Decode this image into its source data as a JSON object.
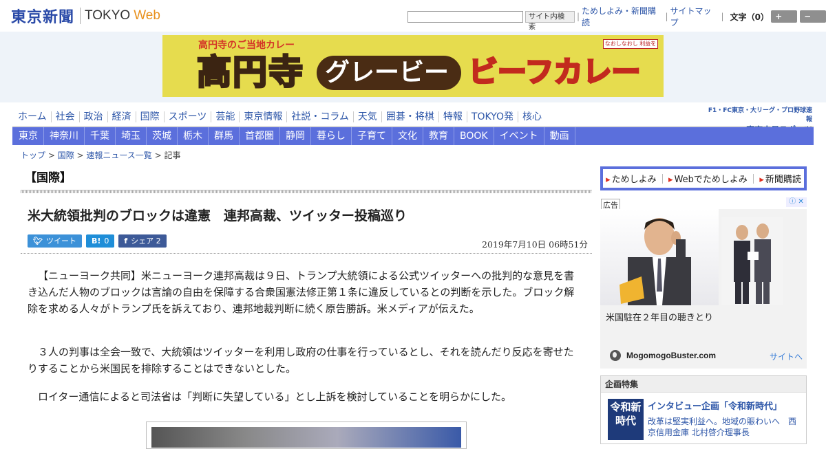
{
  "header": {
    "logo_jp": "東京新聞",
    "logo_tokyo": "TOKYO",
    "logo_web": "Web",
    "search_button": "サイト内検索",
    "links": [
      "ためしよみ・新聞購読",
      "サイトマップ"
    ],
    "font_size_label": "文字（0）",
    "bigger": "+ 大",
    "smaller": "− 小"
  },
  "banner": {
    "top_text": "高円寺のご当地カレー",
    "big_text": "高円寺",
    "pill_text": "グレービー",
    "yellow_text": "ビーフカレー",
    "badge": "なおしなおし 利益を"
  },
  "nav_main": [
    "ホーム",
    "社会",
    "政治",
    "経済",
    "国際",
    "スポーツ",
    "芸能",
    "東京情報",
    "社説・コラム",
    "天気",
    "囲碁・将棋",
    "特報",
    "TOKYO発",
    "核心"
  ],
  "chunichi": {
    "top": "F1・FC東京・大リーグ・プロ野球速報",
    "bottom": "東京中日スポーツ"
  },
  "nav_sub": [
    "東京",
    "神奈川",
    "千葉",
    "埼玉",
    "茨城",
    "栃木",
    "群馬",
    "首都圏",
    "静岡",
    "暮らし",
    "子育て",
    "文化",
    "教育",
    "BOOK",
    "イベント",
    "動画"
  ],
  "breadcrumb": {
    "items": [
      "トップ",
      "国際",
      "速報ニュース一覧"
    ],
    "current": "記事",
    "sep": " > "
  },
  "article": {
    "section": "【国際】",
    "headline": "米大統領批判のブロックは違憲　連邦高裁、ツイッター投稿巡り",
    "date": "2019年7月10日 06時51分",
    "share": {
      "tweet_label": "ツイート",
      "hatena_label": "0",
      "facebook_label": "シェア",
      "facebook_count": "2"
    },
    "paragraphs": [
      "【ニューヨーク共同】米ニューヨーク連邦高裁は９日、トランプ大統領による公式ツイッターへの批判的な意見を書き込んだ人物のブロックは言論の自由を保障する合衆国憲法修正第１条に違反しているとの判断を示した。ブロック解除を求める人々がトランプ氏を訴えており、連邦地裁判断に続く原告勝訴。米メディアが伝えた。",
      "３人の判事は全会一致で、大統領はツイッターを利用し政府の仕事を行っているとし、それを読んだり反応を寄せたりすることから米国民を排除することはできないとした。",
      "ロイター通信によると司法省は「判断に失望している」とし上訴を検討していることを明らかにした。"
    ]
  },
  "sidebar": {
    "promo": [
      "ためしよみ",
      "Webでためしよみ",
      "新聞購読"
    ],
    "ad_label": "広告",
    "ad_caption": "米国駐在２年目の聴きとり",
    "ad_site": "MogomogoBuster.com",
    "ad_link": "サイトへ",
    "feature_head": "企画特集",
    "feature_thumb": "令和新時代",
    "feature_title": "インタビュー企画「令和新時代」",
    "feature_desc": "改革は堅実利益へ。地域の賑わいへ　西京信用金庫 北村啓介理事長"
  }
}
